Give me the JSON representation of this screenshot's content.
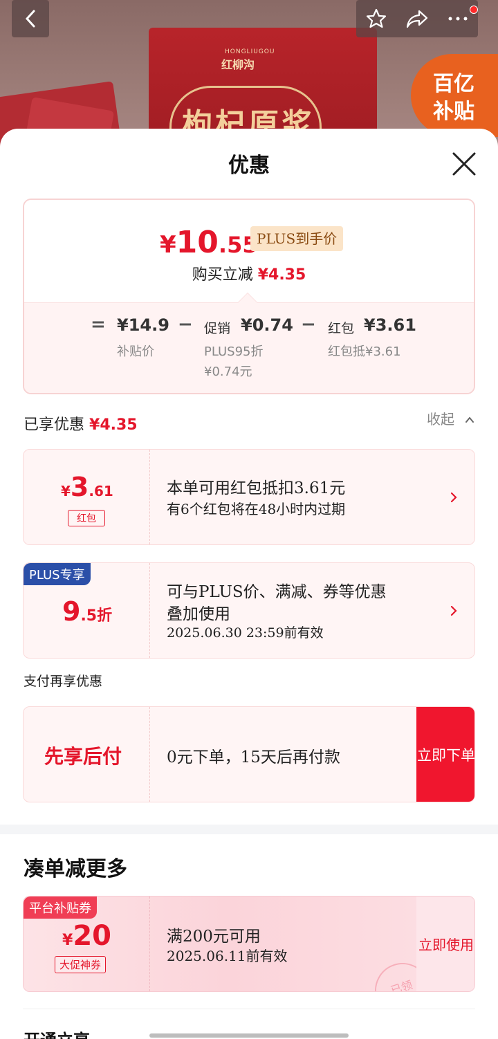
{
  "product": {
    "brand_en": "HONGLIUGOU",
    "brand_cn": "红柳沟",
    "name": "枸杞原浆",
    "subsidy_badge_line1": "百亿",
    "subsidy_badge_line2": "补贴"
  },
  "sheet": {
    "title": "优惠"
  },
  "price_card": {
    "currency": "¥",
    "final_int": "10",
    "final_dec": ".55",
    "plus_tag": "PLUS到手价",
    "instant_cut_label": "购买立减",
    "instant_cut_amount": "¥4.35",
    "equals": "=",
    "minus": "−",
    "subsidy_value": "¥14.9",
    "subsidy_label": "补贴价",
    "promo_label_value": "促销",
    "promo_value": "¥0.74",
    "promo_sub1": "PLUS95折",
    "promo_sub2": "¥0.74元",
    "redpacket_label_value": "红包",
    "redpacket_value": "¥3.61",
    "redpacket_sub": "红包抵¥3.61"
  },
  "enjoyed": {
    "label": "已享优惠",
    "amount": "¥4.35",
    "collapse_label": "收起"
  },
  "red_packet_coupon": {
    "cur": "¥",
    "int": "3",
    "dec": ".61",
    "tag": "红包",
    "line1": "本单可用红包抵扣3.61元",
    "line2": "有6个红包将在48小时内过期"
  },
  "plus_coupon": {
    "badge": "PLUS专享",
    "int": "9",
    "dec": ".5折",
    "line1": "可与PLUS价、满减、券等优惠",
    "line2": "叠加使用",
    "line3": "2025.06.30 23:59前有效"
  },
  "pay": {
    "section_title": "支付再享优惠",
    "name": "先享后付",
    "desc": "0元下单，15天后再付款",
    "button": "立即下单"
  },
  "more": {
    "title": "凑单减更多"
  },
  "platform_coupon": {
    "badge": "平台补贴券",
    "cur": "¥",
    "int": "20",
    "tag": "大促神券",
    "line1": "满200元可用",
    "line2": "2025.06.11前有效",
    "button": "立即使用",
    "stamp": "已领"
  },
  "next_section_peek": "开通立享"
}
